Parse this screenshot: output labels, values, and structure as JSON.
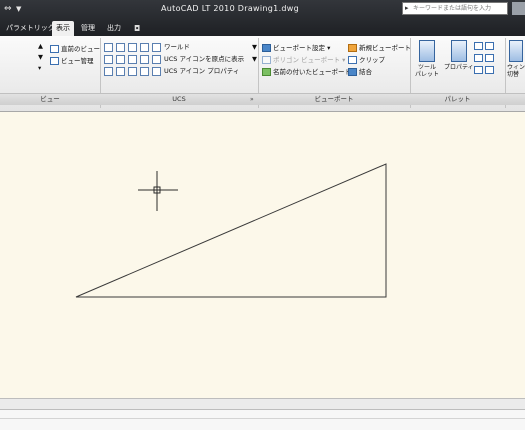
{
  "app": {
    "title": "AutoCAD LT 2010   Drawing1.dwg",
    "search_placeholder": "キーワードまたは語句を入力"
  },
  "tabs": [
    {
      "label": "パラメトリック",
      "active": false
    },
    {
      "label": "表示",
      "active": true
    },
    {
      "label": "管理",
      "active": false
    },
    {
      "label": "出力",
      "active": false
    }
  ],
  "ribbon": {
    "view_panel": {
      "label": "ビュー",
      "previous_view": "直前のビュー",
      "view_manager": "ビュー管理"
    },
    "ucs_panel": {
      "label": "UCS",
      "world": "ワールド",
      "show_icon_at_origin": "UCS アイコンを原点に表示",
      "icon_properties": "UCS アイコン プロパティ"
    },
    "viewports_panel": {
      "label": "ビューポート",
      "viewport_config": "ビューポート設定",
      "viewport_greyed": "ポリゴン ビューポート",
      "named_viewports": "名前の付いたビューポート",
      "new_viewport": "新規ビューポート",
      "clip": "クリップ",
      "join": "結合"
    },
    "palettes_panel": {
      "label": "パレット",
      "tool_palette": "ツール\nパレット",
      "properties": "プロパティ",
      "window_label": "ウィン\n切替"
    }
  },
  "colors": {
    "titlebar": "#2a2c30",
    "viewport_bg": "#fcf8ea",
    "drawing_line": "#3a3a3a"
  }
}
